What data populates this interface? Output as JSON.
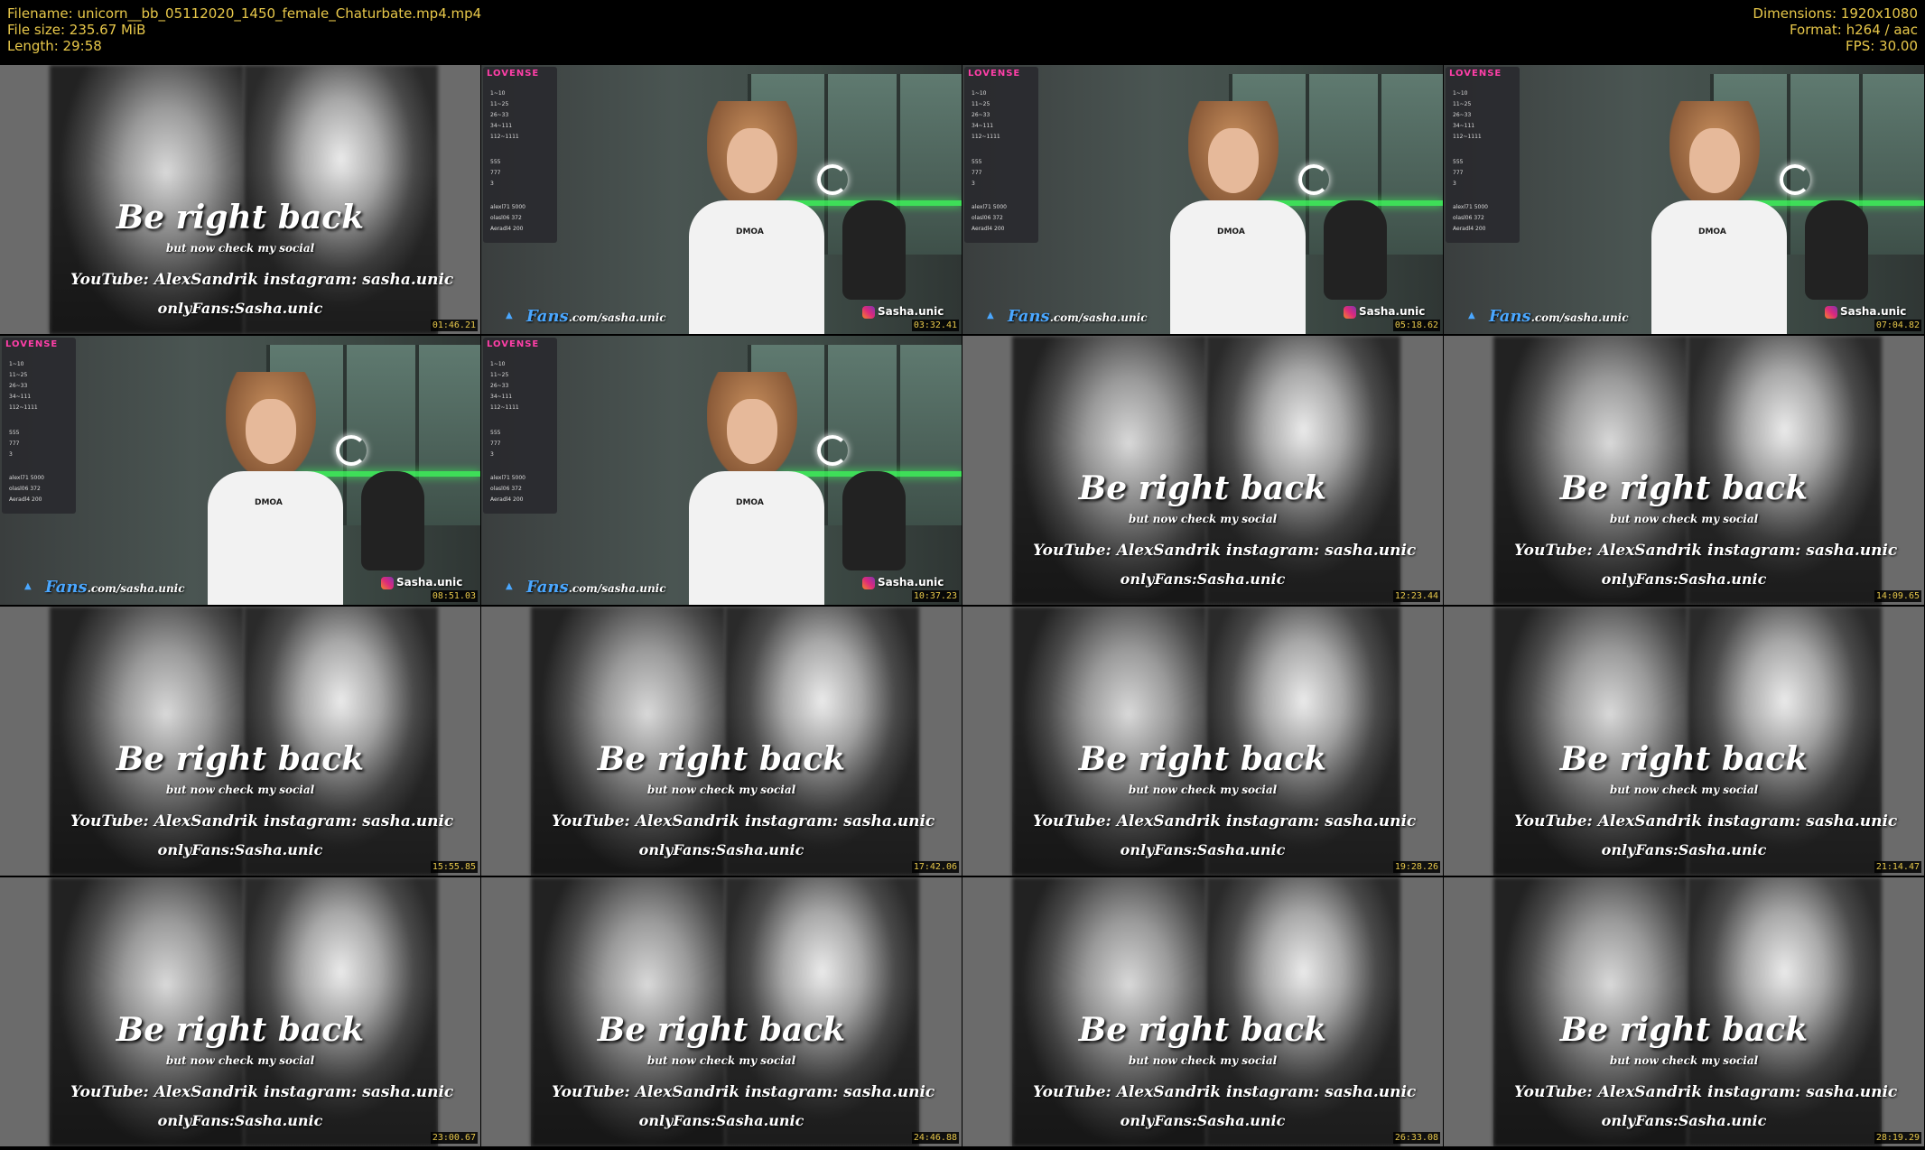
{
  "header": {
    "filename": "Filename: unicorn__bb_05112020_1450_female_Chaturbate.mp4.mp4",
    "filesize": "File size: 235.67 MiB",
    "length": "Length: 29:58",
    "dimensions": "Dimensions: 1920x1080",
    "format": "Format: h264 / aac",
    "fps": "FPS: 30.00"
  },
  "brb": {
    "title": "Be right back",
    "subtitle": "but now check my social",
    "youtube": "YouTube: AlexSandrik",
    "instagram": "instagram: sasha.unic",
    "onlyfans": "onlyFans:Sasha.unic"
  },
  "cam": {
    "panel_brand": "LOVENSE",
    "fans_prefix": "Fans",
    "fans_suffix": ".com/sasha.unic",
    "insta_handle": "Sasha.unic",
    "shirt_logo": "DMOA",
    "panel_rows": [
      "1~10",
      "11~25",
      "26~33",
      "34~111",
      "112~1111",
      "555",
      "777",
      "3",
      "alexl71 5000",
      "olasl06 372",
      "Aeradl4 200"
    ]
  },
  "thumbnails": [
    {
      "type": "brb",
      "timestamp": "01:46.21"
    },
    {
      "type": "cam",
      "timestamp": "03:32.41"
    },
    {
      "type": "cam",
      "timestamp": "05:18.62"
    },
    {
      "type": "cam",
      "timestamp": "07:04.82"
    },
    {
      "type": "cam",
      "timestamp": "08:51.03"
    },
    {
      "type": "cam",
      "timestamp": "10:37.23"
    },
    {
      "type": "brb",
      "timestamp": "12:23.44"
    },
    {
      "type": "brb",
      "timestamp": "14:09.65"
    },
    {
      "type": "brb",
      "timestamp": "15:55.85"
    },
    {
      "type": "brb",
      "timestamp": "17:42.06"
    },
    {
      "type": "brb",
      "timestamp": "19:28.26"
    },
    {
      "type": "brb",
      "timestamp": "21:14.47"
    },
    {
      "type": "brb",
      "timestamp": "23:00.67"
    },
    {
      "type": "brb",
      "timestamp": "24:46.88"
    },
    {
      "type": "brb",
      "timestamp": "26:33.08"
    },
    {
      "type": "brb",
      "timestamp": "28:19.29"
    }
  ]
}
